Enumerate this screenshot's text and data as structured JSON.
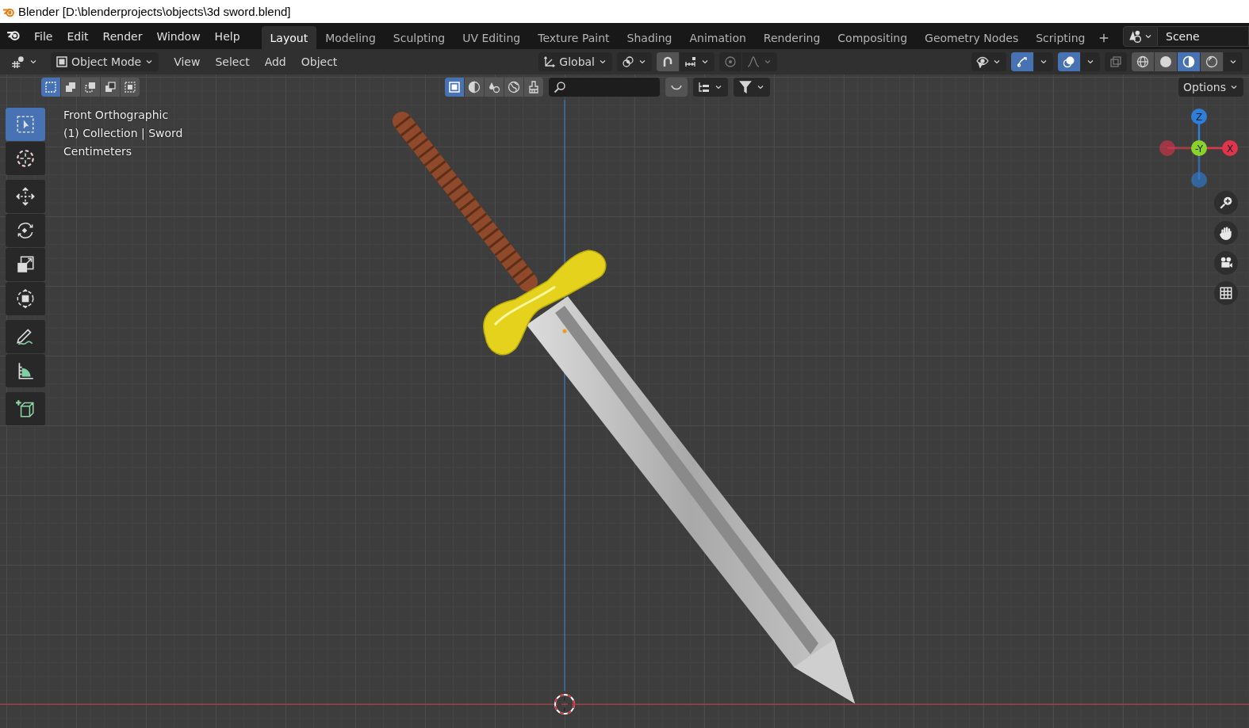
{
  "window": {
    "title": "Blender [D:\\blenderprojects\\objects\\3d sword.blend]"
  },
  "menu": [
    "File",
    "Edit",
    "Render",
    "Window",
    "Help"
  ],
  "workspaces": [
    {
      "label": "Layout",
      "selected": true
    },
    {
      "label": "Modeling",
      "selected": false
    },
    {
      "label": "Sculpting",
      "selected": false
    },
    {
      "label": "UV Editing",
      "selected": false
    },
    {
      "label": "Texture Paint",
      "selected": false
    },
    {
      "label": "Shading",
      "selected": false
    },
    {
      "label": "Animation",
      "selected": false
    },
    {
      "label": "Rendering",
      "selected": false
    },
    {
      "label": "Compositing",
      "selected": false
    },
    {
      "label": "Geometry Nodes",
      "selected": false
    },
    {
      "label": "Scripting",
      "selected": false
    }
  ],
  "scene": "Scene",
  "header": {
    "mode": "Object Mode",
    "menus": [
      "View",
      "Select",
      "Add",
      "Object"
    ],
    "orientation": "Global",
    "snap": {
      "on": true
    },
    "proportional": {
      "on": false
    },
    "gizmos": {
      "on": true
    },
    "overlays": {
      "on": true
    },
    "xray": {
      "on": false
    },
    "shading": [
      {
        "kind": "wireframe",
        "selected": false
      },
      {
        "kind": "solid",
        "selected": false
      },
      {
        "kind": "material",
        "selected": true
      },
      {
        "kind": "rendered",
        "selected": false
      }
    ]
  },
  "tool_settings": {
    "select_modes": [
      {
        "kind": "new",
        "selected": true
      },
      {
        "kind": "extend",
        "selected": false
      },
      {
        "kind": "subtract",
        "selected": false
      },
      {
        "kind": "invert",
        "selected": false
      },
      {
        "kind": "intersect",
        "selected": false
      }
    ],
    "filters": [
      {
        "kind": "square",
        "selected": true
      },
      {
        "kind": "halfsphere",
        "selected": false
      },
      {
        "kind": "drops",
        "selected": false
      },
      {
        "kind": "globe",
        "selected": false
      },
      {
        "kind": "brush",
        "selected": false
      }
    ],
    "options": "Options"
  },
  "viewport": {
    "info": [
      "Front Orthographic",
      "(1) Collection | Sword",
      "Centimeters"
    ],
    "tool_groups": [
      [
        {
          "kind": "select",
          "selected": true
        },
        {
          "kind": "cursor",
          "selected": false
        }
      ],
      [
        {
          "kind": "move",
          "selected": false
        },
        {
          "kind": "rotate",
          "selected": false
        },
        {
          "kind": "scale",
          "selected": false
        },
        {
          "kind": "transform",
          "selected": false
        }
      ],
      [
        {
          "kind": "annotate",
          "selected": false
        },
        {
          "kind": "measure",
          "selected": false
        }
      ],
      [
        {
          "kind": "addcube",
          "selected": false
        }
      ]
    ],
    "axes": [
      {
        "label": "Z",
        "color": "#2f7fd9"
      },
      {
        "label": "-Y",
        "color": "#8ad12a"
      },
      {
        "label": "X",
        "color": "#e0344a"
      }
    ]
  }
}
